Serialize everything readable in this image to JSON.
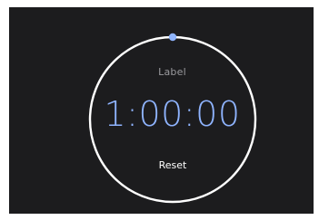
{
  "timer": {
    "label": "Label",
    "time": "1:00:00",
    "reset_label": "Reset",
    "progress": 1.0
  },
  "colors": {
    "background": "#1c1c1e",
    "ring": "#ffffff",
    "accent": "#8fb4ff",
    "label": "#9a9a9e"
  }
}
